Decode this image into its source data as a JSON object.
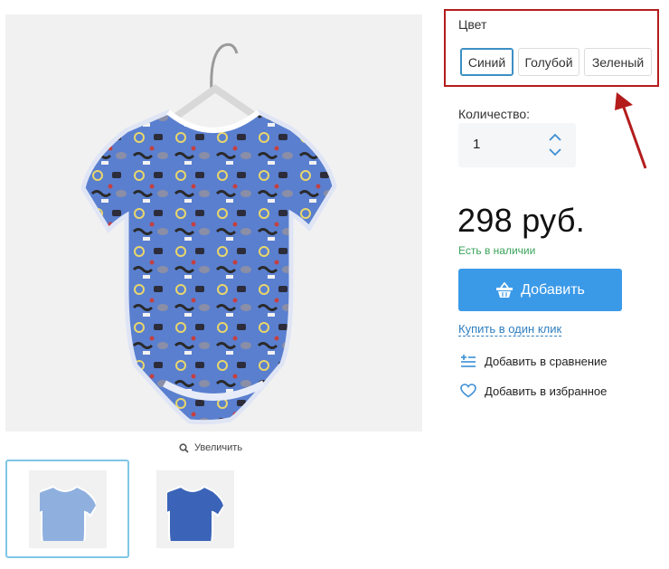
{
  "gallery": {
    "zoom_label": "Увеличить",
    "thumbnails": [
      {
        "variant": "light-blue",
        "active": true
      },
      {
        "variant": "blue",
        "active": false
      }
    ]
  },
  "product": {
    "color_label": "Цвет",
    "colors": [
      {
        "label": "Синий",
        "selected": true
      },
      {
        "label": "Голубой",
        "selected": false
      },
      {
        "label": "Зеленый",
        "selected": false
      }
    ],
    "quantity_label": "Количество:",
    "quantity_value": "1",
    "price": "298 руб.",
    "stock_status": "Есть в наличии",
    "add_button_label": "Добавить",
    "one_click_label": "Купить в один клик",
    "compare_label": "Добавить в сравнение",
    "favorite_label": "Добавить в избранное"
  },
  "colors": {
    "accent": "#3b9ae8",
    "link": "#2f7fc1",
    "in_stock": "#3aa35a",
    "highlight_frame": "#b41c1c",
    "garment_blue": "#5a7fcf"
  },
  "icons": {
    "zoom": "magnifier-icon",
    "add_button": "basket-icon",
    "compare": "compare-list-icon",
    "favorite": "heart-icon",
    "qty_up": "chevron-up-icon",
    "qty_down": "chevron-down-icon"
  }
}
